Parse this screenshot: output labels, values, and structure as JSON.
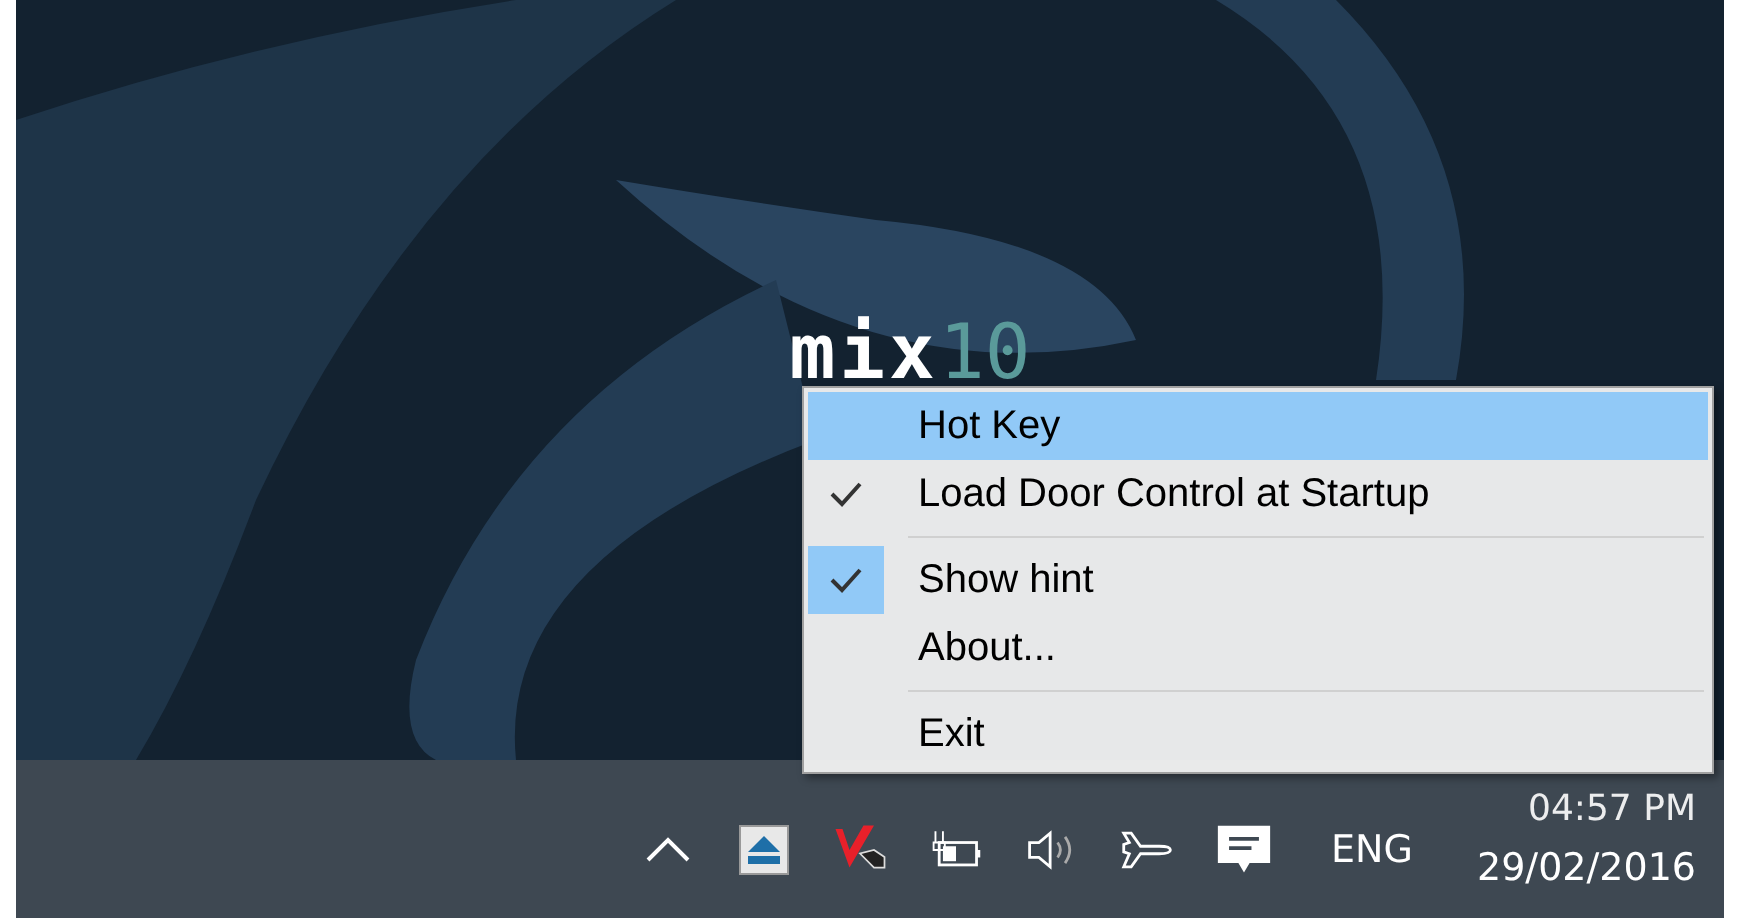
{
  "logo": {
    "text": "mix",
    "suffix": "10"
  },
  "menu": {
    "items": [
      {
        "kind": "item",
        "label": "Hot Key",
        "selected": true,
        "checked": false,
        "boxed": false
      },
      {
        "kind": "item",
        "label": "Load Door Control at Startup",
        "selected": false,
        "checked": true,
        "boxed": false
      },
      {
        "kind": "separator"
      },
      {
        "kind": "item",
        "label": "Show hint",
        "selected": false,
        "checked": true,
        "boxed": true
      },
      {
        "kind": "item",
        "label": "About...",
        "selected": false,
        "checked": false,
        "boxed": false
      },
      {
        "kind": "separator"
      },
      {
        "kind": "item",
        "label": "Exit",
        "selected": false,
        "checked": false,
        "boxed": false
      }
    ]
  },
  "taskbar": {
    "tray": [
      {
        "kind": "chevron"
      },
      {
        "kind": "eject"
      },
      {
        "kind": "antivirus"
      },
      {
        "kind": "battery"
      },
      {
        "kind": "speaker"
      },
      {
        "kind": "airplane"
      },
      {
        "kind": "notification"
      }
    ],
    "language": "ENG",
    "time": "04:57 PM",
    "date": "29/02/2016"
  }
}
